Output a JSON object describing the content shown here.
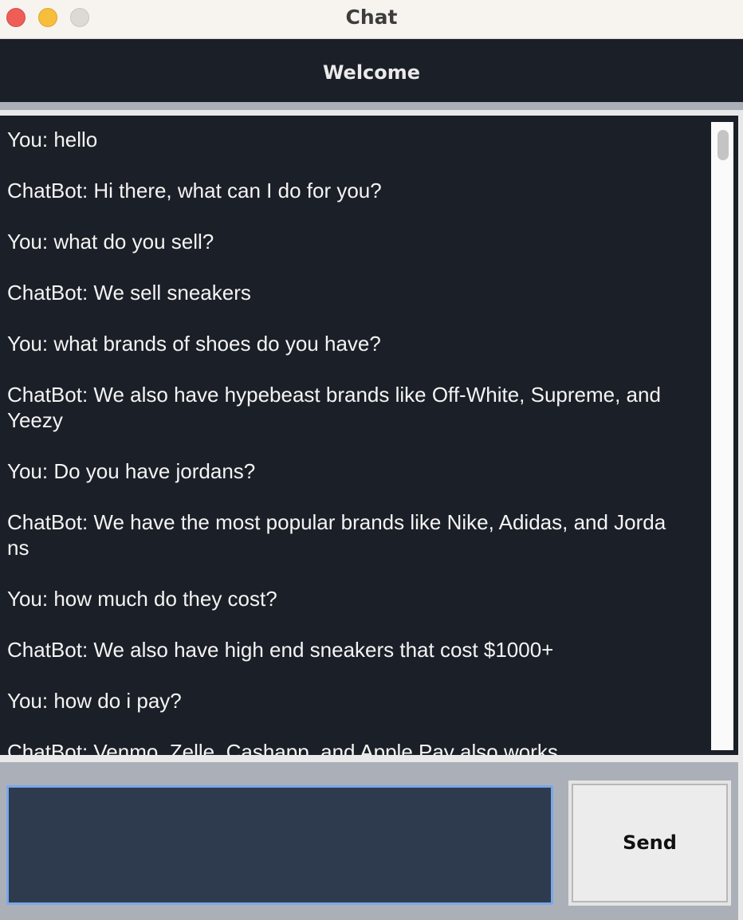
{
  "window": {
    "title": "Chat"
  },
  "header": {
    "title": "Welcome"
  },
  "chat": {
    "messages": [
      "You: hello",
      "ChatBot: Hi there, what can I do for you?",
      "You: what do you sell?",
      "ChatBot: We sell sneakers",
      "You: what brands of shoes do you have?",
      "ChatBot: We also have hypebeast brands like Off-White, Supreme, and\nYeezy",
      "You: Do you have jordans?",
      "ChatBot: We have the most popular brands like Nike, Adidas, and Jorda\nns",
      "You: how much do they cost?",
      "ChatBot: We also have high end sneakers that cost $1000+",
      "You: how do i pay?",
      "ChatBot: Venmo, Zelle, Cashapp, and Apple Pay also works"
    ]
  },
  "composer": {
    "input_value": "",
    "send_label": "Send"
  },
  "colors": {
    "chat_background": "#1b1f27",
    "input_background": "#2e3b4e",
    "input_focus_border": "#7aa7e8"
  },
  "icons": {
    "close": "close-traffic-light-icon",
    "minimize": "minimize-traffic-light-icon",
    "zoom": "zoom-traffic-light-icon"
  }
}
